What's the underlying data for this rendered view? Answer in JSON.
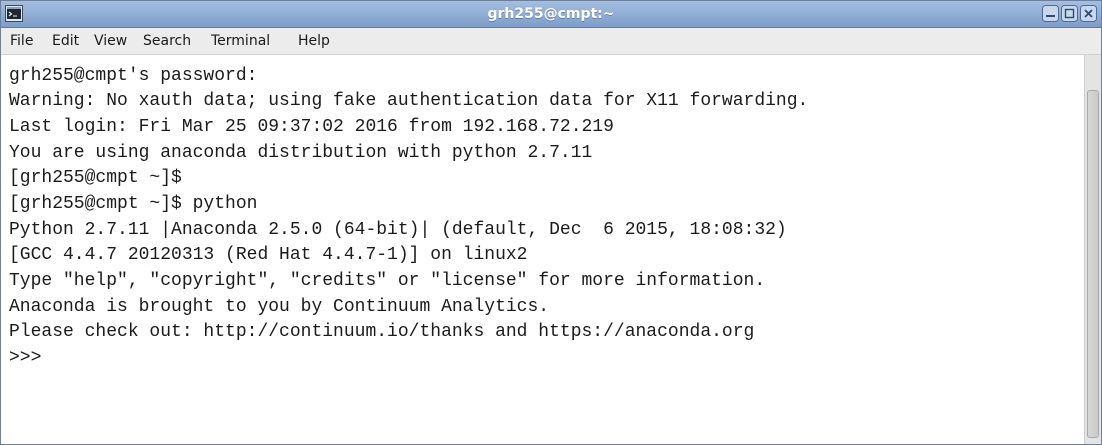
{
  "window": {
    "title": "grh255@cmpt:~",
    "icons": [
      "terminal-app-icon",
      "minimize-icon",
      "maximize-icon",
      "close-icon"
    ],
    "colors": {
      "titlebar": "#8aa7d2",
      "title_text": "#ffffff"
    }
  },
  "menu": {
    "file": "File",
    "edit": "Edit",
    "view": "View",
    "search": "Search",
    "terminal": "Terminal",
    "help": "Help"
  },
  "terminal": {
    "lines": [
      "grh255@cmpt's password:",
      "Warning: No xauth data; using fake authentication data for X11 forwarding.",
      "Last login: Fri Mar 25 09:37:02 2016 from 192.168.72.219",
      "You are using anaconda distribution with python 2.7.11",
      "[grh255@cmpt ~]$",
      "[grh255@cmpt ~]$ python",
      "Python 2.7.11 |Anaconda 2.5.0 (64-bit)| (default, Dec  6 2015, 18:08:32)",
      "[GCC 4.4.7 20120313 (Red Hat 4.4.7-1)] on linux2",
      "Type \"help\", \"copyright\", \"credits\" or \"license\" for more information.",
      "Anaconda is brought to you by Continuum Analytics.",
      "Please check out: http://continuum.io/thanks and https://anaconda.org",
      ">>>"
    ]
  }
}
